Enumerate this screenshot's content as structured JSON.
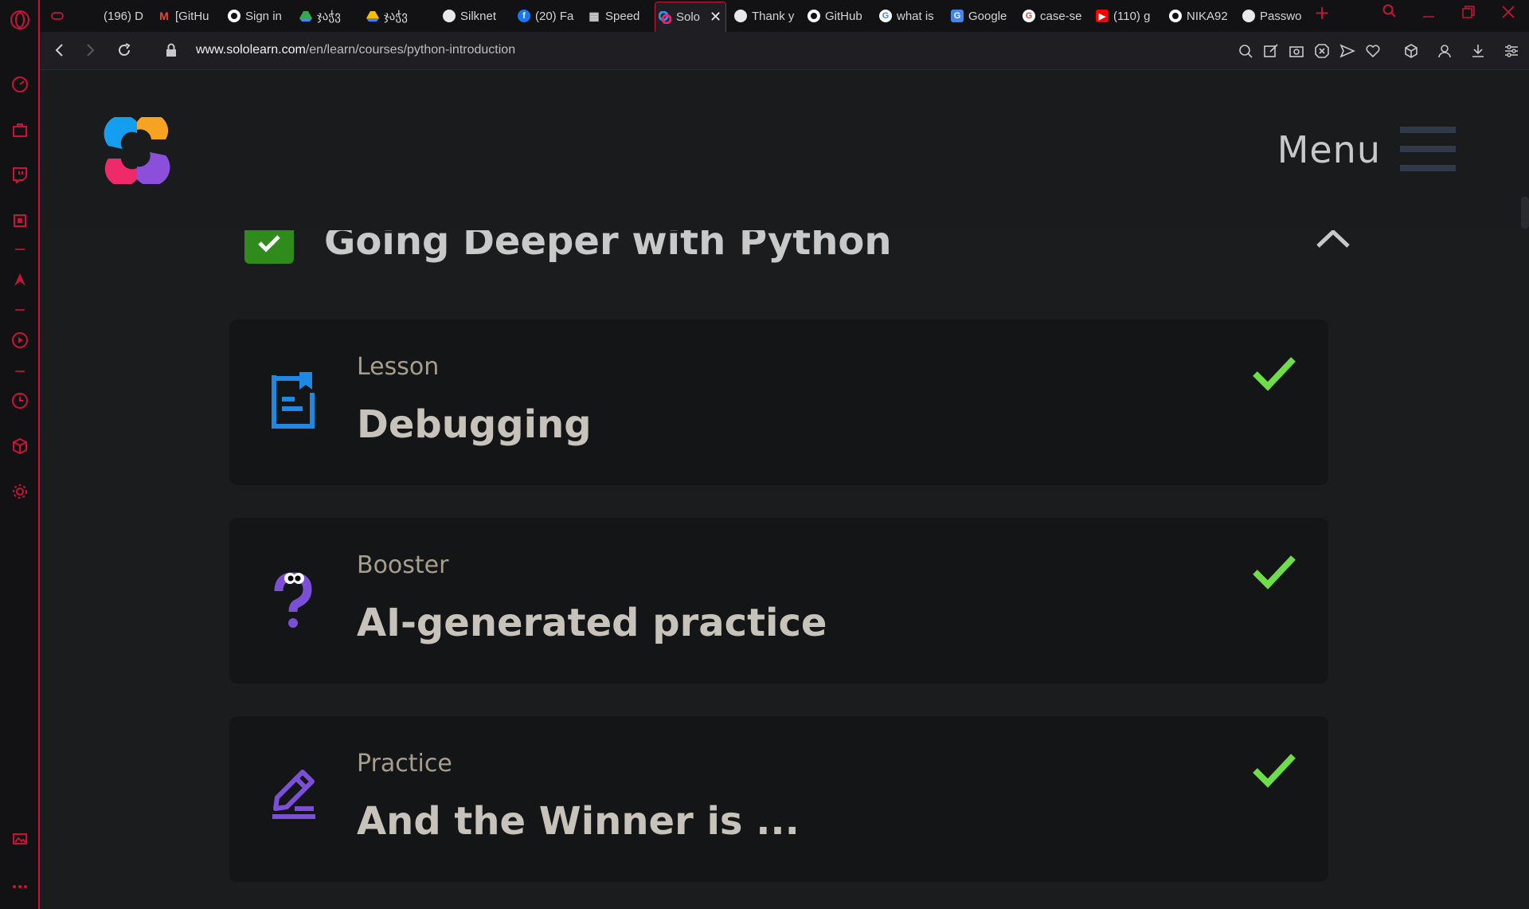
{
  "browser": {
    "tabs": [
      {
        "label": "",
        "icon": "gamepad-icon"
      },
      {
        "label": "(196) D",
        "icon": "discord-icon"
      },
      {
        "label": "[GitHu",
        "icon": "gmail-icon"
      },
      {
        "label": "Sign in",
        "icon": "github-icon"
      },
      {
        "label": "ჯაჭვ",
        "icon": "google-drive-icon"
      },
      {
        "label": "ჯაჭვ",
        "icon": "google-drive-icon"
      },
      {
        "label": "Silknet",
        "icon": "globe-icon"
      },
      {
        "label": "(20) Fa",
        "icon": "facebook-icon"
      },
      {
        "label": "Speed",
        "icon": "grid-icon"
      },
      {
        "label": "Solo",
        "icon": "sololearn-icon",
        "active": true
      },
      {
        "label": "Thank y",
        "icon": "globe-icon"
      },
      {
        "label": "GitHub",
        "icon": "github-icon"
      },
      {
        "label": "what is",
        "icon": "google-icon"
      },
      {
        "label": "Google",
        "icon": "google-translate-icon"
      },
      {
        "label": "case-se",
        "icon": "google-icon"
      },
      {
        "label": "(110) g",
        "icon": "youtube-icon"
      },
      {
        "label": "NIKA92",
        "icon": "github-icon"
      },
      {
        "label": "Passwo",
        "icon": "globe-icon"
      }
    ],
    "url_host": "www.sololearn.com",
    "url_path": "/en/learn/courses/python-introduction",
    "accent": "#c4153a"
  },
  "header": {
    "menu_label": "Menu"
  },
  "module": {
    "title": "Going Deeper with Python",
    "completed": true
  },
  "items": [
    {
      "kind": "Lesson",
      "title": "Debugging",
      "icon": "document-bookmark-icon",
      "completed": true
    },
    {
      "kind": "Booster",
      "title": "AI-generated practice",
      "icon": "question-mark-eyes-icon",
      "completed": true
    },
    {
      "kind": "Practice",
      "title": "And the Winner is ...",
      "icon": "pencil-edit-icon",
      "completed": true
    }
  ],
  "colors": {
    "check_green": "#6fdc4a",
    "module_check_bg": "#2e8b1c",
    "lesson_icon": "#1e88e5",
    "booster_icon": "#7b4fd6",
    "practice_icon": "#7b4fd6"
  }
}
